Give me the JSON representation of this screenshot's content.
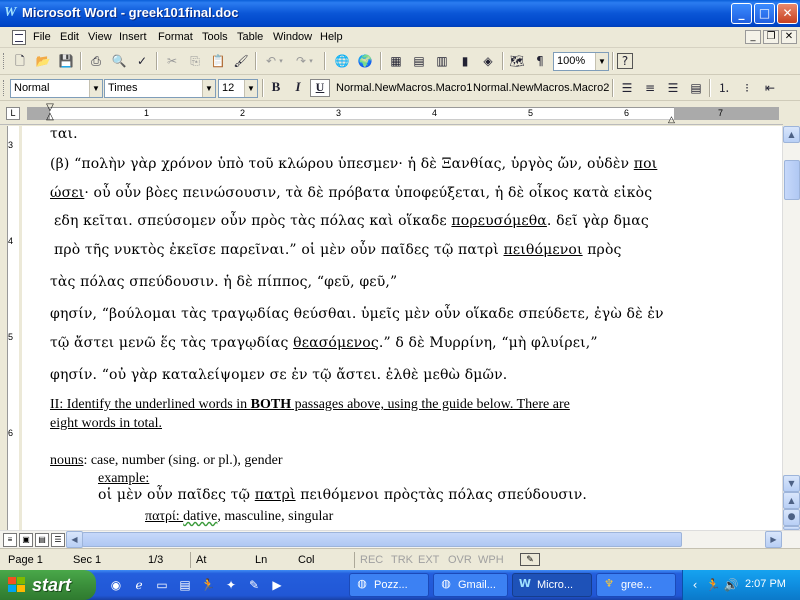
{
  "window": {
    "title": "Microsoft Word - greek101final.doc"
  },
  "menu": [
    "File",
    "Edit",
    "View",
    "Insert",
    "Format",
    "Tools",
    "Table",
    "Window",
    "Help"
  ],
  "standard_toolbar": {
    "zoom": "100%"
  },
  "formatting_toolbar": {
    "style": "Normal",
    "font": "Times",
    "size": "12",
    "macro1": "Normal.NewMacros.Macro1",
    "macro2": "Normal.NewMacros.Macro2"
  },
  "ruler": {
    "numbers": [
      "1",
      "2",
      "3",
      "4",
      "5",
      "6",
      "7"
    ]
  },
  "vruler": {
    "numbers": [
      "3",
      "4",
      "5",
      "6"
    ]
  },
  "document": {
    "line0": "ται.",
    "line1_a": "(β) “πολὴν γὰρ χρόνον ὑπὸ τοῦ κλώρου ὑπεσμεν· ἡ δὲ Ξανθίας, ὑργὸς ὤν, οὐδὲν ",
    "line1_u": "ποι",
    "line2_u": "ώσει",
    "line2_b": "· οὖ οὖν βὸες πεινώσουσιν, τὰ δὲ πρόβατα ὑποφεύξεται, ἡ δὲ οἶκος κατὰ εἰκὸς",
    "line3": "εδη κεῖται. σπεύσομεν οὖν πρὸς τὰς πόλας καὶ οἵκαδε ",
    "line3_u": "πορευσόμεθα",
    "line3_b": ". δεῖ γὰρ δμας",
    "line4": "πρὸ τῆς νυκτὸς ἐκεῖσε παρεῖναι.” οἱ μὲν οὖν παῖδες τῷ πατρὶ ",
    "line4_u": "πειθόμενοι",
    "line4_b": " πρὸς",
    "line5": "τὰς πόλας σπεύδουσιν. ἡ δὲ πίππος, “φεῦ, φεῦ,”",
    "line6": "φησίν, “βούλομαι τὰς τραγῳδίας θεύσθαι.  ὑμεῖς μὲν οὖν οἵκαδε σπεύδετε, ἐγὼ δὲ ἐν",
    "line7": "τῷ ἄστει μενῶ ἕς τὰς τραγῳδίας ",
    "line7_u": "θεασόμενος",
    "line7_b": ".”  δ δὲ Μυρρίνη, “μὴ φλυίρει,”",
    "line8": "φησίν. “οὐ γὰρ καταλείψομεν σε ἐν τῷ ἄστει. ἐλθὲ μεθὼ δμῶν.",
    "instr_pre": "II:  Identify the underlined words in ",
    "instr_bold": "BOTH",
    "instr_post": " passages above, using the guide below. There are",
    "instr2": "eight words in total.",
    "nouns_label": "nouns",
    "nouns_rest": ": case, number (sing. or pl.), gender",
    "example_label": "example:",
    "ex_a": "οἱ μὲν οὖν παῖδες τῷ ",
    "ex_u": "πατρὶ",
    "ex_b": " πειθόμενοι πρὸςτὰς πόλας σπεύδουσιν.",
    "ans_word": "πατρί: ",
    "ans_squig": "dative",
    "ans_rest": ", masculine, singular"
  },
  "status": {
    "page": "Page  1",
    "sec": "Sec  1",
    "pages": "1/3",
    "at": "At",
    "ln": "Ln",
    "col": "Col",
    "rec": "REC",
    "trk": "TRK",
    "ext": "EXT",
    "ovr": "OVR",
    "wph": "WPH"
  },
  "taskbar": {
    "start": "start",
    "tasks": [
      "Pozz...",
      "Gmail...",
      "Micro...",
      "gree..."
    ],
    "clock": "2:07 PM"
  },
  "colors": {
    "titlebar": "#0a55d6",
    "taskbar": "#245edc",
    "start": "#3b8f3b"
  }
}
